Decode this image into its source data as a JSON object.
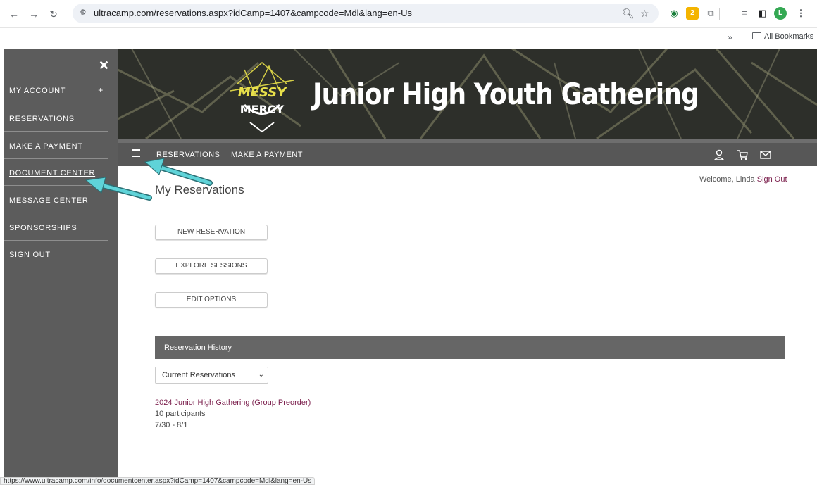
{
  "browser": {
    "url": "ultracamp.com/reservations.aspx?idCamp=1407&campcode=Mdl&lang=en-Us",
    "bookmarks_more": "»",
    "bookmarks_folder": "All Bookmarks",
    "status_url": "https://www.ultracamp.com/info/documentcenter.aspx?idCamp=1407&campcode=Mdl&lang=en-Us",
    "profile_initial": "L",
    "ext_badge": "2"
  },
  "drawer": {
    "close": "✕",
    "items": [
      {
        "label": "MY ACCOUNT",
        "suffix": "+"
      },
      {
        "label": "RESERVATIONS"
      },
      {
        "label": "MAKE A PAYMENT"
      },
      {
        "label": "DOCUMENT CENTER"
      },
      {
        "label": "MESSAGE CENTER"
      },
      {
        "label": "SPONSORSHIPS"
      },
      {
        "label": "SIGN OUT"
      }
    ]
  },
  "banner": {
    "title": "Junior High Youth Gathering",
    "logo_top": "MESSY",
    "logo_bottom": "MERCY"
  },
  "sitenav": {
    "links": [
      "RESERVATIONS",
      "MAKE A PAYMENT"
    ]
  },
  "main": {
    "welcome": "Welcome, Linda",
    "sign_out": "Sign Out",
    "title": "My Reservations",
    "buttons": [
      "NEW RESERVATION",
      "EXPLORE SESSIONS",
      "EDIT OPTIONS"
    ],
    "history_header": "Reservation History",
    "filter_selected": "Current Reservations",
    "reservation": {
      "name": "2024 Junior High Gathering (Group Preorder)",
      "participants": "10 participants",
      "dates": "7/30 - 8/1"
    }
  },
  "colors": {
    "drawer_bg": "#5c5c5c",
    "nav_bg": "#575757",
    "accent_link": "#7a1d4b",
    "annotation_arrow": "#4fd1d9"
  }
}
